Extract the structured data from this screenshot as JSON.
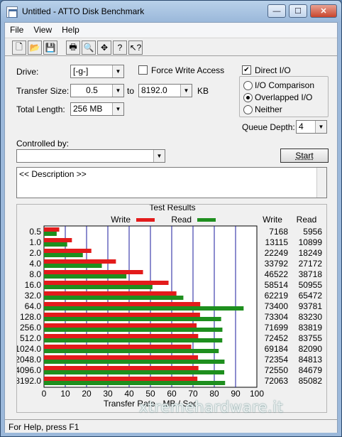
{
  "window": {
    "title": "Untitled - ATTO Disk Benchmark",
    "min": "—",
    "max": "☐",
    "close": "✕"
  },
  "menu": [
    "File",
    "View",
    "Help"
  ],
  "toolbar": [
    {
      "name": "new-icon",
      "glyph": "🗋"
    },
    {
      "name": "open-icon",
      "glyph": "📂"
    },
    {
      "name": "save-icon",
      "glyph": "💾"
    },
    {
      "name": "print-icon",
      "glyph": "🖶"
    },
    {
      "name": "print-preview-icon",
      "glyph": "🔍"
    },
    {
      "name": "move-icon",
      "glyph": "✥"
    },
    {
      "name": "help-icon",
      "glyph": "?"
    },
    {
      "name": "context-help-icon",
      "glyph": "↖?"
    }
  ],
  "settings": {
    "drive_label": "Drive:",
    "drive_value": "[-g-]",
    "force_write_label": "Force Write Access",
    "direct_io_label": "Direct I/O",
    "direct_io_checked": "✔",
    "transfer_size_label": "Transfer Size:",
    "transfer_from": "0.5",
    "to_label": "to",
    "transfer_to": "8192.0",
    "kb_label": "KB",
    "total_length_label": "Total Length:",
    "total_length_value": "256 MB",
    "io_comparison_label": "I/O Comparison",
    "overlapped_label": "Overlapped I/O",
    "neither_label": "Neither",
    "queue_depth_label": "Queue Depth:",
    "queue_depth_value": "4",
    "controlled_by_label": "Controlled by:",
    "controlled_by_value": "",
    "start_label": "Start",
    "description": "<< Description >>"
  },
  "results": {
    "title": "Test Results",
    "write_legend": "Write",
    "read_legend": "Read",
    "write_col": "Write",
    "read_col": "Read"
  },
  "chart_data": {
    "type": "bar",
    "categories": [
      "0.5",
      "1.0",
      "2.0",
      "4.0",
      "8.0",
      "16.0",
      "32.0",
      "64.0",
      "128.0",
      "256.0",
      "512.0",
      "1024.0",
      "2048.0",
      "4096.0",
      "8192.0"
    ],
    "series": [
      {
        "name": "Write",
        "color": "#e31b1b",
        "values": [
          7.168,
          13.115,
          22.249,
          33.792,
          46.522,
          58.514,
          62.219,
          73.4,
          73.304,
          71.699,
          72.452,
          69.184,
          72.354,
          72.55,
          72.063
        ],
        "labels": [
          "7168",
          "13115",
          "22249",
          "33792",
          "46522",
          "58514",
          "62219",
          "73400",
          "73304",
          "71699",
          "72452",
          "69184",
          "72354",
          "72550",
          "72063"
        ]
      },
      {
        "name": "Read",
        "color": "#1e8f1e",
        "values": [
          5.956,
          10.899,
          18.249,
          27.172,
          38.718,
          50.955,
          65.472,
          93.781,
          83.23,
          83.819,
          83.755,
          82.09,
          84.813,
          84.679,
          85.082
        ],
        "labels": [
          "5956",
          "10899",
          "18249",
          "27172",
          "38718",
          "50955",
          "65472",
          "93781",
          "83230",
          "83819",
          "83755",
          "82090",
          "84813",
          "84679",
          "85082"
        ]
      }
    ],
    "xticks": [
      "0",
      "10",
      "20",
      "30",
      "40",
      "50",
      "60",
      "70",
      "80",
      "90",
      "100"
    ],
    "xlim": [
      0,
      100
    ],
    "xlabel": "Transfer Rate - MB / Sec",
    "grid": true
  },
  "statusbar": {
    "text": "For Help, press F1"
  },
  "watermark": "xtremehardware.it"
}
